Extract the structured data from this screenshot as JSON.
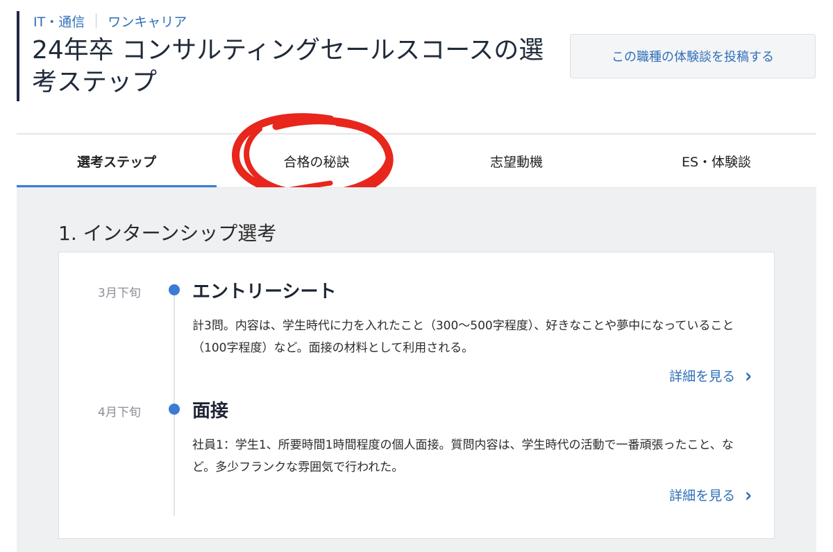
{
  "breadcrumb": {
    "category": "IT・通信",
    "tag": "ワンキャリア"
  },
  "page_title": "24年卒 コンサルティングセールスコースの選考ステップ",
  "post_button_label": "この職種の体験談を投稿する",
  "tabs": [
    {
      "label": "選考ステップ",
      "active": true
    },
    {
      "label": "合格の秘訣",
      "active": false
    },
    {
      "label": "志望動機",
      "active": false
    },
    {
      "label": "ES・体験談",
      "active": false
    }
  ],
  "section": {
    "title": "1. インターンシップ選考",
    "steps": [
      {
        "date": "3月下旬",
        "title": "エントリーシート",
        "body": "計3問。内容は、学生時代に力を入れたこと（300〜500字程度）、好きなことや夢中になっていること（100字程度）など。面接の材料として利用される。",
        "link": "詳細を見る"
      },
      {
        "date": "4月下旬",
        "title": "面接",
        "body": "社員1：学生1、所要時間1時間程度の個人面接。質問内容は、学生時代の活動で一番頑張ったこと、など。多少フランクな雰囲気で行われた。",
        "link": "詳細を見る"
      }
    ]
  },
  "colors": {
    "accent": "#3a7bd5",
    "link": "#2f6fb7",
    "annotation": "#e8261c"
  },
  "icons": {
    "detail_link": "chevron-right-icon",
    "timeline_marker": "dot-icon"
  }
}
